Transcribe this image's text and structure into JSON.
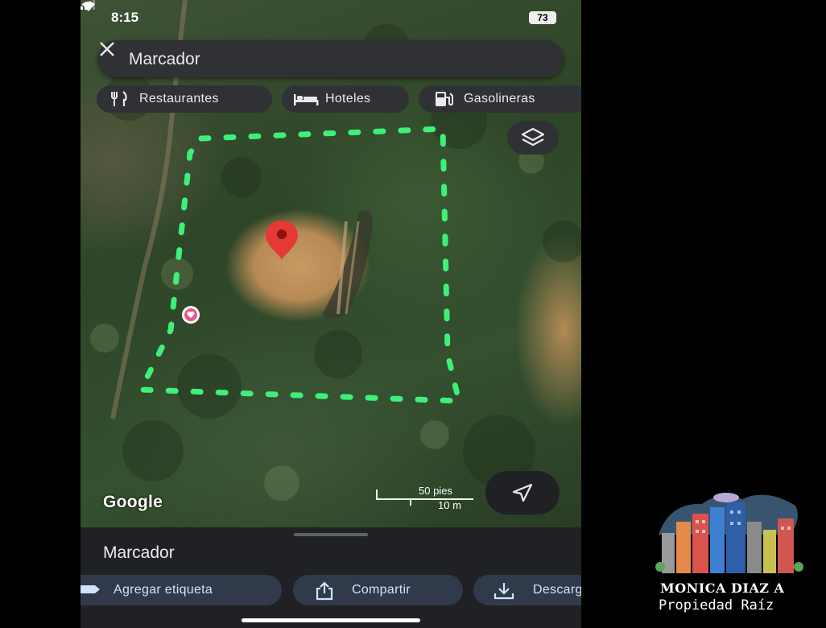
{
  "status_bar": {
    "time": "8:15",
    "battery": "73"
  },
  "search": {
    "text": "Marcador"
  },
  "chips": [
    {
      "label": "Restaurantes",
      "icon": "fork-knife-icon"
    },
    {
      "label": "Hoteles",
      "icon": "bed-icon"
    },
    {
      "label": "Gasolineras",
      "icon": "gas-station-icon"
    }
  ],
  "map": {
    "attribution": "Google",
    "scale": {
      "feet": "50 pies",
      "meters": "10 m"
    },
    "pin_color": "#e53935",
    "boundary_color": "#3ef07a"
  },
  "sheet": {
    "title": "Marcador",
    "actions": [
      {
        "label": "Agregar etiqueta",
        "icon": "label-icon"
      },
      {
        "label": "Compartir",
        "icon": "share-icon"
      },
      {
        "label": "Descargar",
        "icon": "download-icon"
      }
    ]
  },
  "watermark": {
    "name": "MONICA DIAZ A",
    "subtitle": "Propiedad Raíz"
  }
}
